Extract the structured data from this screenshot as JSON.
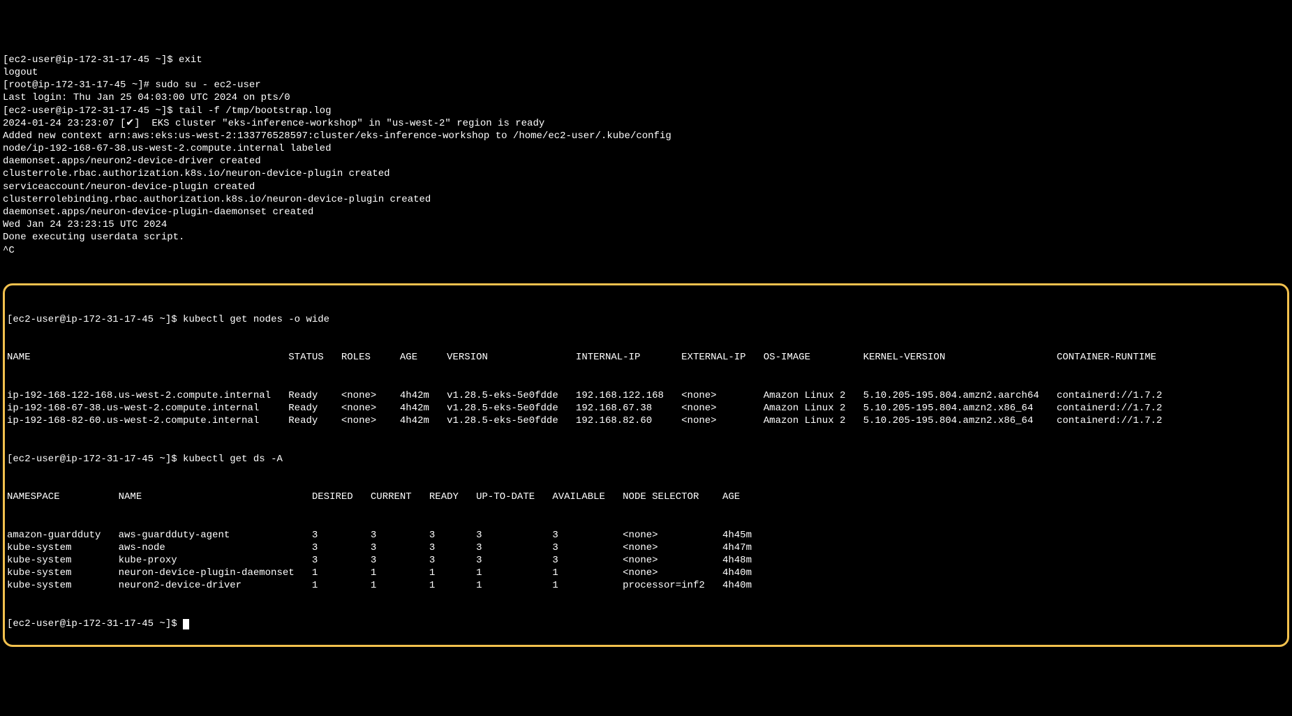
{
  "pre_lines": [
    "[ec2-user@ip-172-31-17-45 ~]$ exit",
    "logout",
    "[root@ip-172-31-17-45 ~]# sudo su - ec2-user",
    "Last login: Thu Jan 25 04:03:00 UTC 2024 on pts/0",
    "[ec2-user@ip-172-31-17-45 ~]$ tail -f /tmp/bootstrap.log",
    "2024-01-24 23:23:07 [✔]  EKS cluster \"eks-inference-workshop\" in \"us-west-2\" region is ready",
    "Added new context arn:aws:eks:us-west-2:133776528597:cluster/eks-inference-workshop to /home/ec2-user/.kube/config",
    "node/ip-192-168-67-38.us-west-2.compute.internal labeled",
    "daemonset.apps/neuron2-device-driver created",
    "clusterrole.rbac.authorization.k8s.io/neuron-device-plugin created",
    "serviceaccount/neuron-device-plugin created",
    "clusterrolebinding.rbac.authorization.k8s.io/neuron-device-plugin created",
    "daemonset.apps/neuron-device-plugin-daemonset created",
    "Wed Jan 24 23:23:15 UTC 2024",
    "Done executing userdata script.",
    "^C"
  ],
  "box": {
    "cmd_nodes_prompt": "[ec2-user@ip-172-31-17-45 ~]$ ",
    "cmd_nodes": "kubectl get nodes -o wide",
    "nodes_header": {
      "name": "NAME",
      "status": "STATUS",
      "roles": "ROLES",
      "age": "AGE",
      "version": "VERSION",
      "internal_ip": "INTERNAL-IP",
      "external_ip": "EXTERNAL-IP",
      "os_image": "OS-IMAGE",
      "kernel": "KERNEL-VERSION",
      "runtime": "CONTAINER-RUNTIME"
    },
    "nodes": [
      {
        "name": "ip-192-168-122-168.us-west-2.compute.internal",
        "status": "Ready",
        "roles": "<none>",
        "age": "4h42m",
        "version": "v1.28.5-eks-5e0fdde",
        "internal_ip": "192.168.122.168",
        "external_ip": "<none>",
        "os_image": "Amazon Linux 2",
        "kernel": "5.10.205-195.804.amzn2.aarch64",
        "runtime": "containerd://1.7.2"
      },
      {
        "name": "ip-192-168-67-38.us-west-2.compute.internal",
        "status": "Ready",
        "roles": "<none>",
        "age": "4h42m",
        "version": "v1.28.5-eks-5e0fdde",
        "internal_ip": "192.168.67.38",
        "external_ip": "<none>",
        "os_image": "Amazon Linux 2",
        "kernel": "5.10.205-195.804.amzn2.x86_64",
        "runtime": "containerd://1.7.2"
      },
      {
        "name": "ip-192-168-82-60.us-west-2.compute.internal",
        "status": "Ready",
        "roles": "<none>",
        "age": "4h42m",
        "version": "v1.28.5-eks-5e0fdde",
        "internal_ip": "192.168.82.60",
        "external_ip": "<none>",
        "os_image": "Amazon Linux 2",
        "kernel": "5.10.205-195.804.amzn2.x86_64",
        "runtime": "containerd://1.7.2"
      }
    ],
    "cmd_ds_prompt": "[ec2-user@ip-172-31-17-45 ~]$ ",
    "cmd_ds": "kubectl get ds -A",
    "ds_header": {
      "namespace": "NAMESPACE",
      "name": "NAME",
      "desired": "DESIRED",
      "current": "CURRENT",
      "ready": "READY",
      "uptodate": "UP-TO-DATE",
      "available": "AVAILABLE",
      "selector": "NODE SELECTOR",
      "age": "AGE"
    },
    "ds": [
      {
        "namespace": "amazon-guardduty",
        "name": "aws-guardduty-agent",
        "desired": "3",
        "current": "3",
        "ready": "3",
        "uptodate": "3",
        "available": "3",
        "selector": "<none>",
        "age": "4h45m"
      },
      {
        "namespace": "kube-system",
        "name": "aws-node",
        "desired": "3",
        "current": "3",
        "ready": "3",
        "uptodate": "3",
        "available": "3",
        "selector": "<none>",
        "age": "4h47m"
      },
      {
        "namespace": "kube-system",
        "name": "kube-proxy",
        "desired": "3",
        "current": "3",
        "ready": "3",
        "uptodate": "3",
        "available": "3",
        "selector": "<none>",
        "age": "4h48m"
      },
      {
        "namespace": "kube-system",
        "name": "neuron-device-plugin-daemonset",
        "desired": "1",
        "current": "1",
        "ready": "1",
        "uptodate": "1",
        "available": "1",
        "selector": "<none>",
        "age": "4h40m"
      },
      {
        "namespace": "kube-system",
        "name": "neuron2-device-driver",
        "desired": "1",
        "current": "1",
        "ready": "1",
        "uptodate": "1",
        "available": "1",
        "selector": "processor=inf2",
        "age": "4h40m"
      }
    ],
    "final_prompt": "[ec2-user@ip-172-31-17-45 ~]$ "
  },
  "col_widths": {
    "nodes": {
      "name": 48,
      "status": 9,
      "roles": 10,
      "age": 8,
      "version": 22,
      "internal_ip": 18,
      "external_ip": 14,
      "os_image": 17,
      "kernel": 33,
      "runtime": 20
    },
    "ds": {
      "namespace": 19,
      "name": 33,
      "desired": 10,
      "current": 10,
      "ready": 8,
      "uptodate": 13,
      "available": 12,
      "selector": 17,
      "age": 8
    }
  }
}
